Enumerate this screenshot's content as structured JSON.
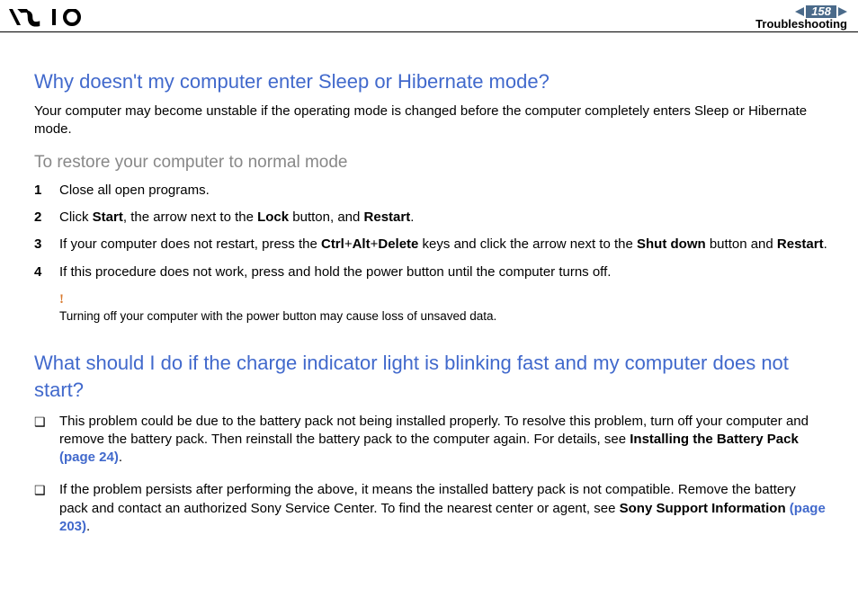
{
  "header": {
    "page_number": "158",
    "section": "Troubleshooting"
  },
  "q1": {
    "title": "Why doesn't my computer enter Sleep or Hibernate mode?",
    "intro": "Your computer may become unstable if the operating mode is changed before the computer completely enters Sleep or Hibernate mode.",
    "subhead": "To restore your computer to normal mode",
    "steps": {
      "s1": {
        "n": "1",
        "t": "Close all open programs."
      },
      "s2": {
        "n": "2",
        "t_pre": "Click ",
        "b1": "Start",
        "t_mid1": ", the arrow next to the ",
        "b2": "Lock",
        "t_mid2": " button, and ",
        "b3": "Restart",
        "t_post": "."
      },
      "s3": {
        "n": "3",
        "t_pre": "If your computer does not restart, press the ",
        "b1": "Ctrl",
        "plus1": "+",
        "b2": "Alt",
        "plus2": "+",
        "b3": "Delete",
        "t_mid": " keys and click the arrow next to the ",
        "b4": "Shut down",
        "t_mid2": " button and ",
        "b5": "Restart",
        "t_post": "."
      },
      "s4": {
        "n": "4",
        "t": "If this procedure does not work, press and hold the power button until the computer turns off."
      }
    },
    "warn_bang": "!",
    "warn_text": "Turning off your computer with the power button may cause loss of unsaved data."
  },
  "q2": {
    "title": "What should I do if the charge indicator light is blinking fast and my computer does not start?",
    "bullets": {
      "b1": {
        "sq": "❑",
        "t1": "This problem could be due to the battery pack not being installed properly. To resolve this problem, turn off your computer and remove the battery pack. Then reinstall the battery pack to the computer again. For details, see ",
        "bold1": "Installing the Battery Pack ",
        "link1": "(page 24)",
        "t2": "."
      },
      "b2": {
        "sq": "❑",
        "t1": "If the problem persists after performing the above, it means the installed battery pack is not compatible. Remove the battery pack and contact an authorized Sony Service Center. To find the nearest center or agent, see ",
        "bold1": "Sony Support Information ",
        "link1": "(page 203)",
        "t2": "."
      }
    }
  }
}
